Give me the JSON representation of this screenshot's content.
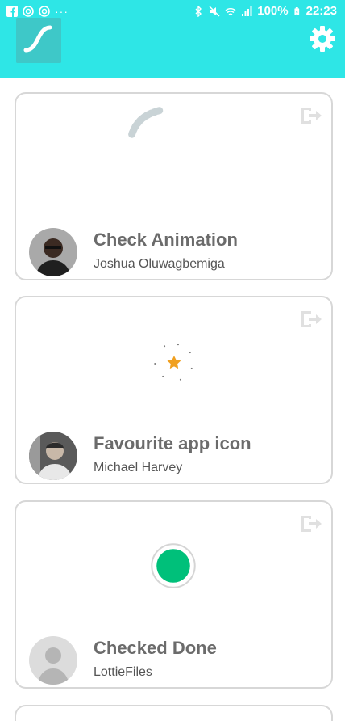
{
  "status_bar": {
    "dots": "···",
    "battery_text": "100%",
    "time": "22:23"
  },
  "colors": {
    "header": "#2ee6e6",
    "card_border": "#d7d7d7",
    "title_text": "#6b6b6b",
    "done_green": "#00c07a"
  },
  "header": {
    "logo_icon": "lottie-logo-icon",
    "settings_icon": "gear-icon"
  },
  "cards": [
    {
      "title": "Check Animation",
      "author": "Joshua Oluwagbemiga",
      "share_icon": "exit-icon"
    },
    {
      "title": "Favourite app icon",
      "author": "Michael Harvey",
      "share_icon": "exit-icon"
    },
    {
      "title": "Checked Done",
      "author": "LottieFiles",
      "share_icon": "exit-icon"
    }
  ]
}
